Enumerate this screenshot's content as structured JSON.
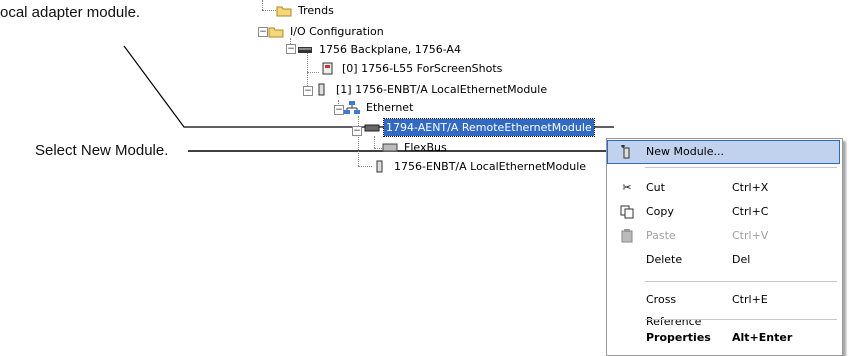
{
  "callouts": {
    "adapter": "ocal adapter module.",
    "select": "Select  New Module."
  },
  "tree": {
    "trends": "Trends",
    "io_config": "I/O Configuration",
    "backplane": "1756 Backplane, 1756-A4",
    "controller": "[0] 1756-L55 ForScreenShots",
    "enbt_slot1": "[1] 1756-ENBT/A LocalEthernetModule",
    "ethernet": "Ethernet",
    "aent": "1794-AENT/A RemoteEthernetModule",
    "flexbus": "FlexBus",
    "enbt_local": "1756-ENBT/A LocalEthernetModule"
  },
  "context_menu": {
    "items": [
      {
        "label": "New Module...",
        "shortcut": "",
        "icon": "new-module-icon"
      },
      {
        "label": "Cut",
        "shortcut": "Ctrl+X",
        "icon": "scissors-icon"
      },
      {
        "label": "Copy",
        "shortcut": "Ctrl+C",
        "icon": "copy-icon"
      },
      {
        "label": "Paste",
        "shortcut": "Ctrl+V",
        "icon": "paste-icon"
      },
      {
        "label": "Delete",
        "shortcut": "Del",
        "icon": ""
      },
      {
        "label": "Cross Reference",
        "shortcut": "Ctrl+E",
        "icon": ""
      },
      {
        "label": "Properties",
        "shortcut": "Alt+Enter",
        "icon": ""
      }
    ]
  },
  "colors": {
    "selection": "#316ac5",
    "menu_highlight": "#c1d2ee"
  }
}
